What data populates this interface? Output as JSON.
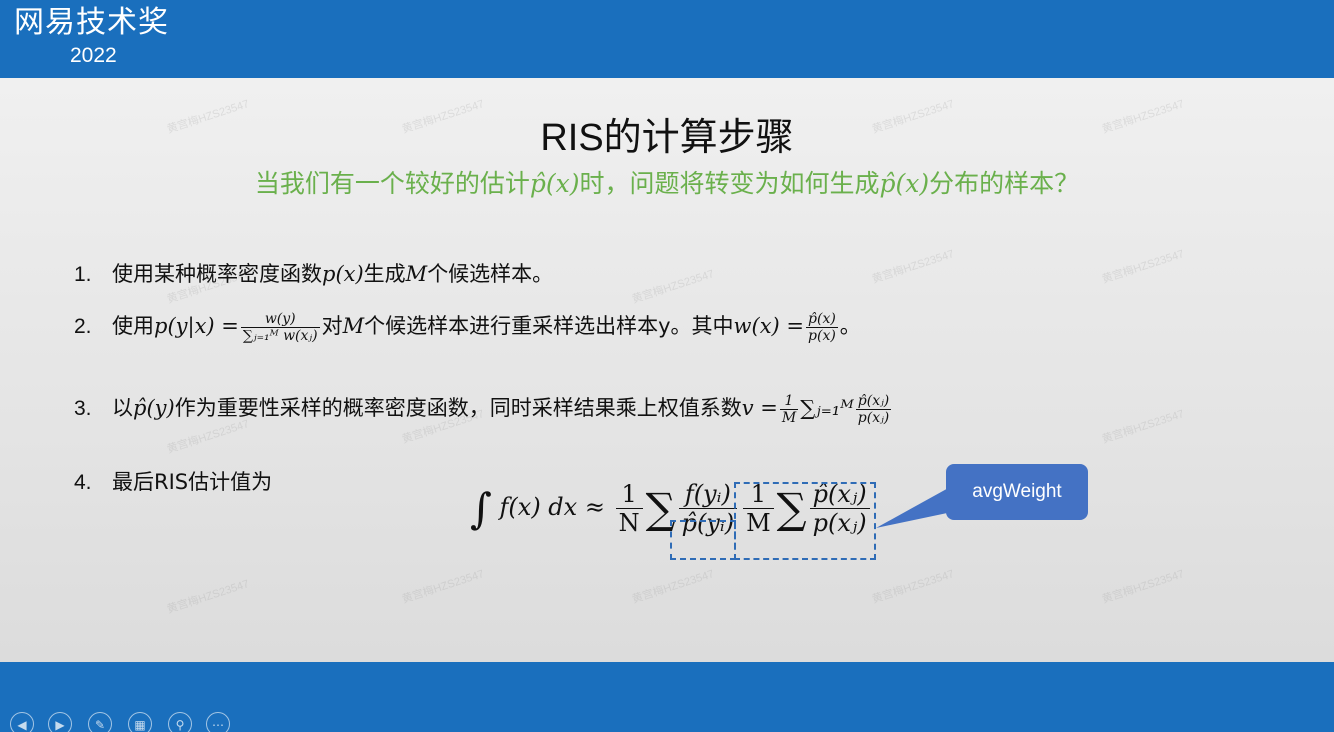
{
  "header": {
    "brand": "网易技术奖",
    "year": "2022"
  },
  "slide": {
    "title": "RIS的计算步骤",
    "subtitle_pre": "当我们有一个较好的估计",
    "subtitle_sym1": "p̂(x)",
    "subtitle_mid": "时，问题将转变为如何生成",
    "subtitle_sym2": "p̂(x)",
    "subtitle_post": "分布的样本？",
    "items": [
      {
        "num": "1.",
        "pre": "使用某种概率密度函数",
        "s1": "p(x)",
        "mid": "生成",
        "s2": "M",
        "post": "个候选样本。"
      },
      {
        "num": "2.",
        "pre": "使用",
        "s1": "p(y|x) =",
        "f1n": "w(y)",
        "f1d": "∑ⱼ₌₁ᴹ w(xⱼ)",
        "mid": "对",
        "s2": "M",
        "post": "个候选样本进行重采样选出样本y。其中",
        "s3": "w(x) =",
        "f2n": "p̂(x)",
        "f2d": "p(x)",
        "end": "。"
      },
      {
        "num": "3.",
        "pre": "以",
        "s1": "p̂(y)",
        "mid": "作为重要性采样的概率密度函数，同时采样结果乘上权值系数",
        "s2": "v =",
        "f1n": "1",
        "f1d": "M",
        "s3": "∑ⱼ₌₁ᴹ",
        "f2n": "p̂(xⱼ)",
        "f2d": "p(xⱼ)"
      },
      {
        "num": "4.",
        "pre": "最后RIS估计值为"
      }
    ],
    "formula": {
      "integral": "∫",
      "integrand": "f(x) dx ≈",
      "n1": "1",
      "d1": "N",
      "sum": "∑",
      "n2": "f(yᵢ)",
      "d2": "p̂(yᵢ)",
      "n3": "1",
      "d3": "M",
      "n4": "p̂(xⱼ)",
      "d4": "p(xⱼ)"
    },
    "callout": "avgWeight",
    "watermark": "黄宫梅HZS23547"
  },
  "controls": [
    "prev-icon",
    "next-icon",
    "pen-icon",
    "slides-icon",
    "zoom-icon",
    "more-icon"
  ],
  "colors": {
    "bar": "#1a6fbd",
    "subtitle": "#6ab04c",
    "callout": "#4472c4"
  }
}
